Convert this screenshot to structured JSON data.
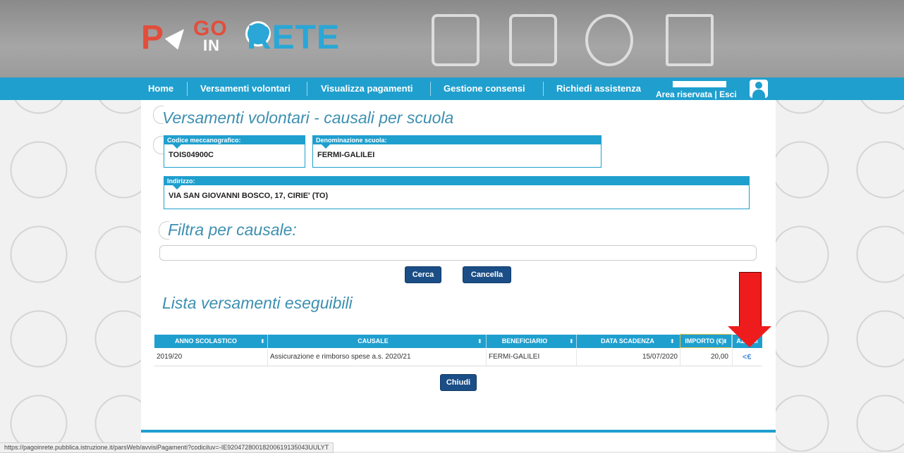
{
  "colors": {
    "accent": "#1f9fce",
    "button": "#1b4e86",
    "logo_red": "#e24e3b",
    "logo_blue": "#2aa7d6",
    "arrow": "#ee1c1c"
  },
  "logo": {
    "p": "P",
    "go": "GO",
    "in": "IN",
    "rete": "RETE"
  },
  "header_icons": [
    "bus-icon",
    "school-icon",
    "meal-icon",
    "museum-icon"
  ],
  "nav": {
    "items": [
      "Home",
      "Versamenti volontari",
      "Visualizza pagamenti",
      "Gestione consensi",
      "Richiedi assistenza"
    ],
    "area": "Area riservata | Esci"
  },
  "page": {
    "title": "Versamenti volontari - causali per scuola",
    "codice_label": "Codice meccanografico:",
    "codice_value": "TOIS04900C",
    "denominazione_label": "Denominazione scuola:",
    "denominazione_value": "FERMI-GALILEI",
    "indirizzo_label": "Indirizzo:",
    "indirizzo_value": "VIA SAN GIOVANNI BOSCO, 17, CIRIE' (TO)",
    "filter_title": "Filtra per causale:",
    "filter_value": "",
    "cerca": "Cerca",
    "cancella": "Cancella",
    "list_title": "Lista versamenti eseguibili",
    "chiudi": "Chiudi"
  },
  "table": {
    "headers": [
      "ANNO SCOLASTICO",
      "CAUSALE",
      "BENEFICIARIO",
      "DATA SCADENZA",
      "IMPORTO (€)",
      "AZIONI"
    ],
    "rows": [
      {
        "anno": "2019/20",
        "causale": "Assicurazione e rimborso spese a.s. 2020/21",
        "beneficiario": "FERMI-GALILEI",
        "scadenza": "15/07/2020",
        "importo": "20,00",
        "azione": "<€"
      }
    ]
  },
  "status_url": "https://pagoinrete.pubblica.istruzione.it/parsWeb/avvisiPagamenti?codiciluv=-IE92047280018200619135043UULYT"
}
